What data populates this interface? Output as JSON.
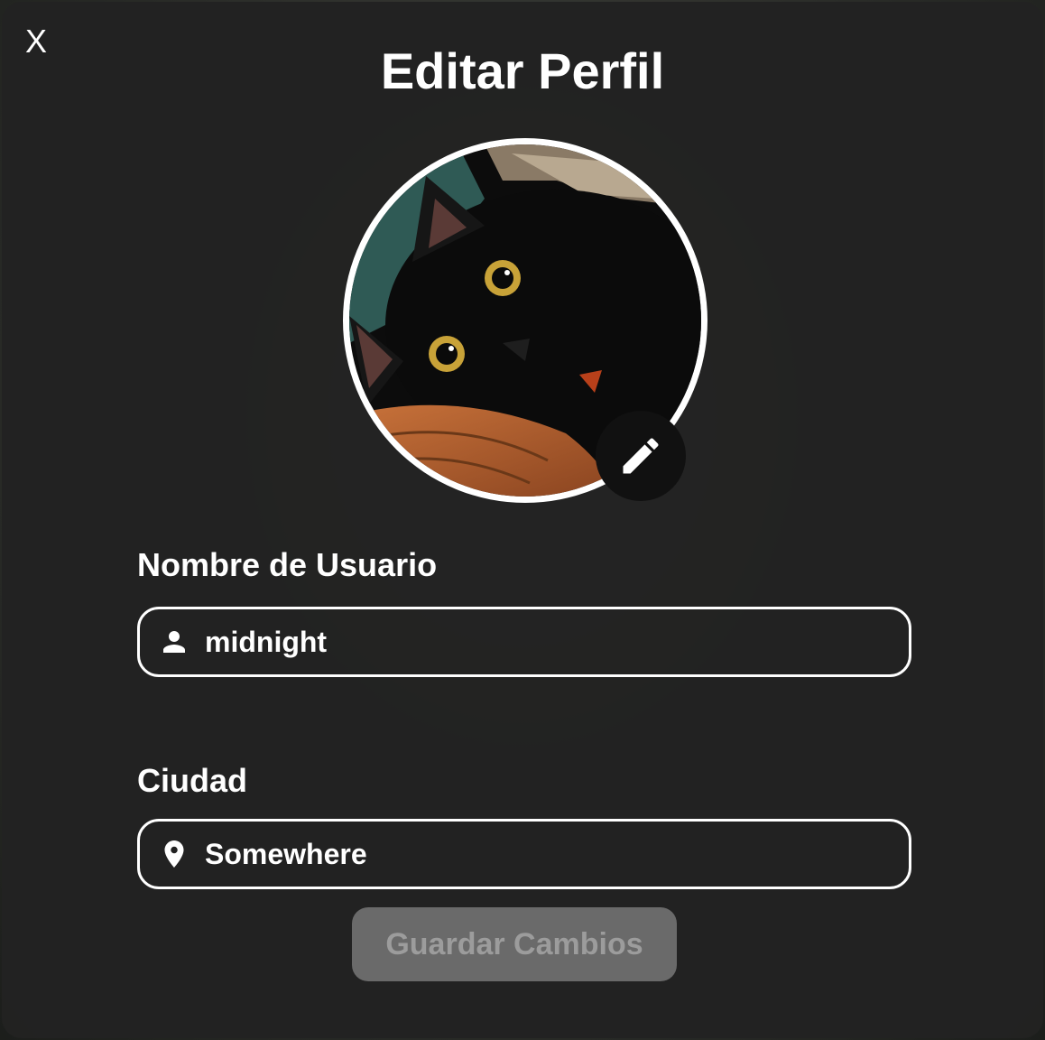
{
  "dialog": {
    "close_label": "X",
    "title": "Editar Perfil"
  },
  "avatar": {
    "edit_icon": "pencil-icon"
  },
  "form": {
    "username": {
      "label": "Nombre de Usuario",
      "value": "midnight",
      "icon": "person-icon"
    },
    "city": {
      "label": "Ciudad",
      "value": "Somewhere",
      "icon": "location-pin-icon"
    },
    "save_label": "Guardar Cambios"
  },
  "colors": {
    "modal_bg": "#222222",
    "text": "#ffffff",
    "field_border": "#ffffff",
    "save_disabled_bg": "#6a6a6a",
    "save_disabled_text": "#9c9c9c"
  }
}
